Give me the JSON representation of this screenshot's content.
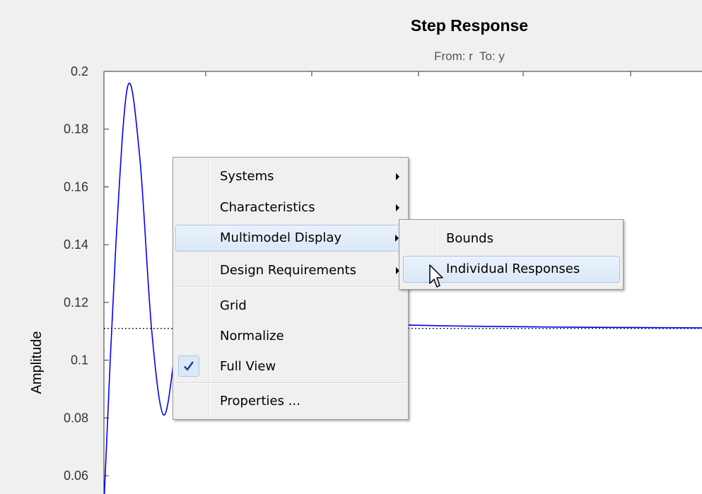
{
  "chart_data": {
    "type": "line",
    "title": "Step Response",
    "subtitle": "From: r  To: y",
    "xlabel": "",
    "ylabel": "Amplitude",
    "ylim": [
      0.05,
      0.2
    ],
    "yticks": [
      0.06,
      0.08,
      0.1,
      0.12,
      0.14,
      0.16,
      0.18,
      0.2
    ],
    "ytick_labels": [
      "0.06",
      "0.08",
      "0.1",
      "0.12",
      "0.14",
      "0.16",
      "0.18",
      "0.2"
    ],
    "grid": false,
    "steady_state_value": 0.111,
    "series": [
      {
        "x": [
          0,
          0.02,
          0.04,
          0.06,
          0.08,
          0.1,
          0.12,
          0.14,
          0.16,
          0.18,
          0.2,
          0.22,
          0.24,
          0.26,
          0.3,
          0.35,
          0.4,
          0.5,
          0.6,
          0.8,
          1.0
        ],
        "y": [
          0.05,
          0.14,
          0.195,
          0.17,
          0.11,
          0.081,
          0.105,
          0.14,
          0.143,
          0.125,
          0.113,
          0.11,
          0.114,
          0.116,
          0.1145,
          0.1135,
          0.1128,
          0.1122,
          0.1118,
          0.1114,
          0.1112
        ],
        "color": "#0000ff"
      }
    ]
  },
  "context_menu": {
    "items": [
      {
        "label": "Systems",
        "submenu": true
      },
      {
        "label": "Characteristics",
        "submenu": true
      },
      {
        "label": "Multimodel Display",
        "submenu": true
      },
      {
        "label": "Design Requirements",
        "submenu": true
      },
      {
        "label": "Grid"
      },
      {
        "label": "Normalize"
      },
      {
        "label": "Full View",
        "checked": true
      },
      {
        "label": "Properties ..."
      }
    ]
  },
  "submenu": {
    "items": [
      {
        "label": "Bounds"
      },
      {
        "label": "Individual Responses"
      }
    ]
  },
  "colors": {
    "accent": "#a8c6ec",
    "highlight": "#dbe8f7",
    "line": "#0000ff"
  },
  "icons": {
    "checkmark": "checkmark-icon",
    "cursor": "mouse-cursor-icon",
    "submenu": "submenu-arrow-icon"
  }
}
